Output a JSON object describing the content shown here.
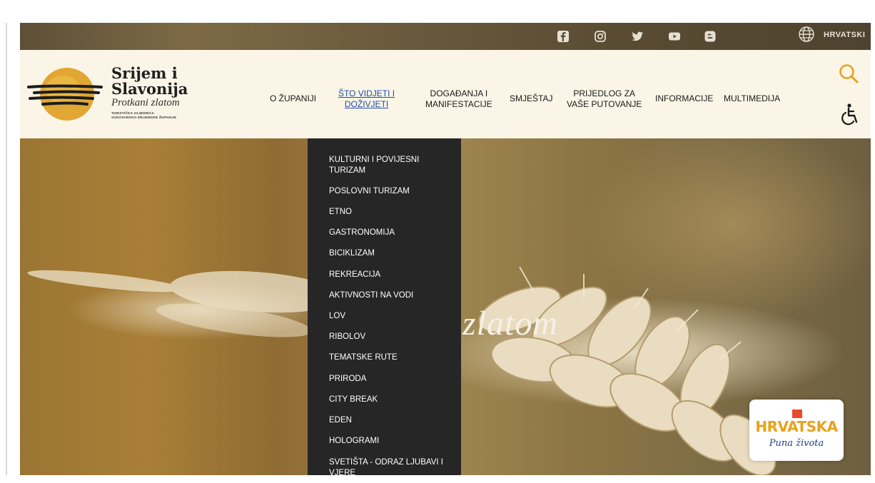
{
  "social": {
    "icons": [
      "facebook-icon",
      "instagram-icon",
      "twitter-icon",
      "youtube-icon",
      "blogger-icon"
    ]
  },
  "language": {
    "label": "HRVATSKI"
  },
  "brand": {
    "line1": "Srijem i",
    "line2": "Slavonija",
    "tagline": "Protkani zlatom",
    "org_line1": "TURISTIČKA ZAJEDNICA",
    "org_line2": "VUKOVARSKO-SRIJEMSKE ŽUPANIJE"
  },
  "nav": {
    "items": [
      {
        "label": "O ŽUPANIJI"
      },
      {
        "label1": "ŠTO VIDJETI I",
        "label2": "DOŽIVJETI"
      },
      {
        "label1": "DOGAĐANJA I",
        "label2": "MANIFESTACIJE"
      },
      {
        "label": "SMJEŠTAJ"
      },
      {
        "label1": "PRIJEDLOG ZA",
        "label2": "VAŠE PUTOVANJE"
      },
      {
        "label": "INFORMACIJE"
      },
      {
        "label": "MULTIMEDIJA"
      }
    ]
  },
  "hero": {
    "text": "zlatom"
  },
  "dropdown": {
    "items": [
      {
        "label1": "KULTURNI I POVIJESNI",
        "label2": "TURIZAM"
      },
      {
        "label1": "POSLOVNI TURIZAM"
      },
      {
        "label1": "ETNO"
      },
      {
        "label1": "GASTRONOMIJA"
      },
      {
        "label1": "BICIKLIZAM"
      },
      {
        "label1": "REKREACIJA"
      },
      {
        "label1": "AKTIVNOSTI NA VODI"
      },
      {
        "label1": "LOV"
      },
      {
        "label1": "RIBOLOV"
      },
      {
        "label1": "TEMATSKE RUTE"
      },
      {
        "label1": "PRIRODA"
      },
      {
        "label1": "CITY BREAK"
      },
      {
        "label1": "EDEN"
      },
      {
        "label1": "HOLOGRAMI"
      },
      {
        "label1": "SVETIŠTA - ODRAZ LJUBAVI I",
        "label2": "VJERE"
      }
    ]
  },
  "badge": {
    "title": "HRVATSKA",
    "subtitle": "Puna života"
  },
  "colors": {
    "header_bg": "#faf5e7",
    "dropdown_bg": "#262626",
    "active_link": "#1f4fa8",
    "search_icon": "#e8a21a"
  }
}
